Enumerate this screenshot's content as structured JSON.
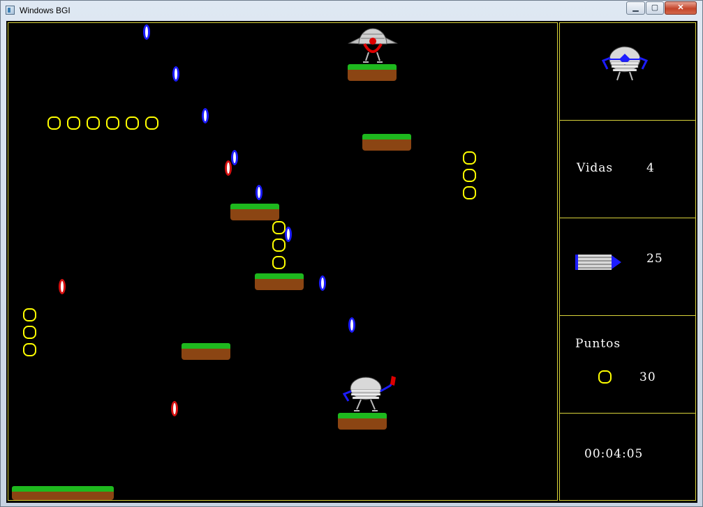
{
  "window": {
    "title": "Windows BGI",
    "minimize_glyph": "▁",
    "maximize_glyph": "▢",
    "close_glyph": "✕"
  },
  "hud": {
    "lives_label": "Vidas",
    "lives_value": "4",
    "ammo_value": "25",
    "points_label": "Puntos",
    "points_value": "30",
    "timer": "00:04:05"
  },
  "colors": {
    "frame": "#d9d33a",
    "coin": "#ffff00",
    "crystal_blue": "#1c1cff",
    "crystal_red": "#d41010",
    "grass": "#1eb81e",
    "dirt": "#8b4513"
  },
  "sprites": {
    "player": "robot-player-icon",
    "enemy": "winged-robot-enemy-icon",
    "ammo": "bullet-ammo-icon",
    "coin": "coin-ring-icon"
  }
}
